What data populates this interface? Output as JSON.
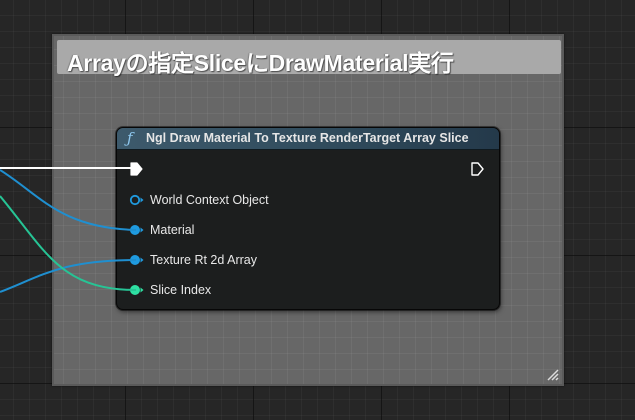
{
  "comment": {
    "title": "Arrayの指定SliceにDrawMaterial実行",
    "background_color": "#676767",
    "header_color": "#a9a9a9"
  },
  "node": {
    "type_icon": "ƒ",
    "title": "Ngl Draw Material To Texture RenderTarget Array Slice",
    "header_color": "#3d5a6c",
    "pins": [
      {
        "label": "World Context Object",
        "type": "object",
        "connected": false,
        "color": "#1f9be0"
      },
      {
        "label": "Material",
        "type": "object",
        "connected": true,
        "color": "#1f9be0"
      },
      {
        "label": "Texture Rt 2d Array",
        "type": "object",
        "connected": true,
        "color": "#1f9be0"
      },
      {
        "label": "Slice Index",
        "type": "integer",
        "connected": true,
        "color": "#2ee0a2"
      }
    ]
  },
  "wires": {
    "exec_color": "#ffffff",
    "object_color": "#1f8fd0",
    "integer_color": "#26c495"
  },
  "icons": {
    "exec_in": "exec-pin-filled",
    "exec_out": "exec-pin-outline",
    "resize": "resize-grip-icon"
  }
}
